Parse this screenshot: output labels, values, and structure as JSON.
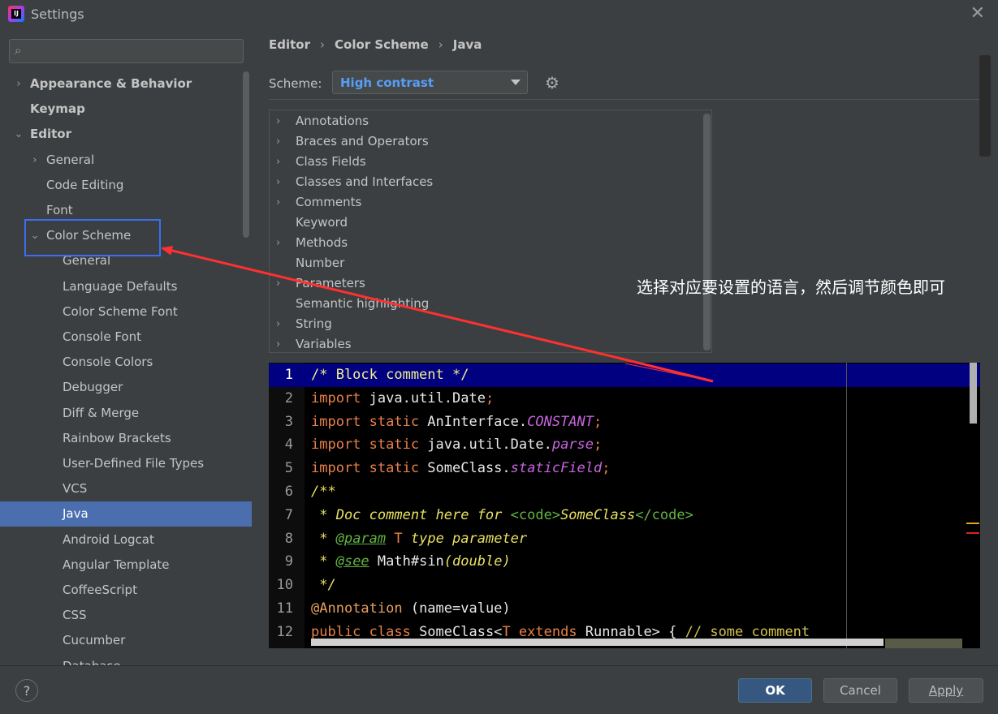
{
  "window": {
    "title": "Settings",
    "logo_text": "IJ"
  },
  "sidebar": {
    "search_placeholder": "",
    "items": [
      {
        "label": "Appearance & Behavior",
        "level": 0,
        "arrow": "›",
        "bold": true
      },
      {
        "label": "Keymap",
        "level": 0,
        "arrow": "",
        "bold": true
      },
      {
        "label": "Editor",
        "level": 0,
        "arrow": "⌄",
        "bold": true
      },
      {
        "label": "General",
        "level": 1,
        "arrow": "›"
      },
      {
        "label": "Code Editing",
        "level": 1,
        "arrow": ""
      },
      {
        "label": "Font",
        "level": 1,
        "arrow": ""
      },
      {
        "label": "Color Scheme",
        "level": 1,
        "arrow": "⌄"
      },
      {
        "label": "General",
        "level": 2,
        "arrow": ""
      },
      {
        "label": "Language Defaults",
        "level": 2,
        "arrow": ""
      },
      {
        "label": "Color Scheme Font",
        "level": 2,
        "arrow": ""
      },
      {
        "label": "Console Font",
        "level": 2,
        "arrow": ""
      },
      {
        "label": "Console Colors",
        "level": 2,
        "arrow": ""
      },
      {
        "label": "Debugger",
        "level": 2,
        "arrow": ""
      },
      {
        "label": "Diff & Merge",
        "level": 2,
        "arrow": ""
      },
      {
        "label": "Rainbow Brackets",
        "level": 2,
        "arrow": ""
      },
      {
        "label": "User-Defined File Types",
        "level": 2,
        "arrow": ""
      },
      {
        "label": "VCS",
        "level": 2,
        "arrow": ""
      },
      {
        "label": "Java",
        "level": 2,
        "arrow": "",
        "selected": true
      },
      {
        "label": "Android Logcat",
        "level": 2,
        "arrow": ""
      },
      {
        "label": "Angular Template",
        "level": 2,
        "arrow": ""
      },
      {
        "label": "CoffeeScript",
        "level": 2,
        "arrow": ""
      },
      {
        "label": "CSS",
        "level": 2,
        "arrow": ""
      },
      {
        "label": "Cucumber",
        "level": 2,
        "arrow": ""
      },
      {
        "label": "Database",
        "level": 2,
        "arrow": ""
      }
    ]
  },
  "breadcrumb": {
    "part1": "Editor",
    "part2": "Color Scheme",
    "part3": "Java",
    "sep": "›"
  },
  "scheme": {
    "label": "Scheme:",
    "value": "High contrast"
  },
  "categories": [
    {
      "label": "Annotations",
      "arrow": "›"
    },
    {
      "label": "Braces and Operators",
      "arrow": "›"
    },
    {
      "label": "Class Fields",
      "arrow": "›"
    },
    {
      "label": "Classes and Interfaces",
      "arrow": "›"
    },
    {
      "label": "Comments",
      "arrow": "›"
    },
    {
      "label": "Keyword",
      "arrow": ""
    },
    {
      "label": "Methods",
      "arrow": "›"
    },
    {
      "label": "Number",
      "arrow": ""
    },
    {
      "label": "Parameters",
      "arrow": "›"
    },
    {
      "label": "Semantic highlighting",
      "arrow": ""
    },
    {
      "label": "String",
      "arrow": "›"
    },
    {
      "label": "Variables",
      "arrow": "›"
    }
  ],
  "annotation_text": "选择对应要设置的语言，然后调节颜色即可",
  "editor": {
    "current_line": 1,
    "lines": [
      {
        "n": "1",
        "parts": [
          [
            "c-com",
            "/* Block comment */"
          ]
        ]
      },
      {
        "n": "2",
        "parts": [
          [
            "c-kw",
            "import"
          ],
          [
            "",
            " java.util.Date"
          ],
          [
            "c-kw",
            ";"
          ]
        ]
      },
      {
        "n": "3",
        "parts": [
          [
            "c-kw",
            "import static"
          ],
          [
            "",
            " AnInterface."
          ],
          [
            "c-const",
            "CONSTANT"
          ],
          [
            "c-kw",
            ";"
          ]
        ]
      },
      {
        "n": "4",
        "parts": [
          [
            "c-kw",
            "import static"
          ],
          [
            "",
            " java.util.Date."
          ],
          [
            "c-const",
            "parse"
          ],
          [
            "c-kw",
            ";"
          ]
        ]
      },
      {
        "n": "5",
        "parts": [
          [
            "c-kw",
            "import static"
          ],
          [
            "",
            " SomeClass."
          ],
          [
            "c-const",
            "staticField"
          ],
          [
            "c-kw",
            ";"
          ]
        ]
      },
      {
        "n": "6",
        "parts": [
          [
            "c-doc",
            "/**"
          ]
        ]
      },
      {
        "n": "7",
        "parts": [
          [
            "c-doc",
            " * Doc comment here for "
          ],
          [
            "c-tag",
            "<code>"
          ],
          [
            "c-doc",
            "SomeClass"
          ],
          [
            "c-tag",
            "</code>"
          ]
        ]
      },
      {
        "n": "8",
        "parts": [
          [
            "c-doc",
            " * "
          ],
          [
            "c-dtag",
            "@param"
          ],
          [
            "c-type",
            " T"
          ],
          [
            "c-doc",
            " type parameter"
          ]
        ]
      },
      {
        "n": "9",
        "parts": [
          [
            "c-doc",
            " * "
          ],
          [
            "c-dtag",
            "@see"
          ],
          [
            "",
            " Math#sin"
          ],
          [
            "c-doc",
            "(double)"
          ]
        ]
      },
      {
        "n": "10",
        "parts": [
          [
            "c-doc",
            " */"
          ]
        ]
      },
      {
        "n": "11",
        "parts": [
          [
            "c-ann",
            "@Annotation"
          ],
          [
            "",
            " (name=value)"
          ]
        ]
      },
      {
        "n": "12",
        "parts": [
          [
            "c-kw",
            "public class"
          ],
          [
            "",
            " SomeClass<"
          ],
          [
            "c-type",
            "T"
          ],
          [
            "c-kw",
            " extends"
          ],
          [
            "",
            " Runnable> { "
          ],
          [
            "c-lcom",
            "// some comment"
          ]
        ]
      }
    ]
  },
  "footer": {
    "help": "?",
    "ok": "OK",
    "cancel": "Cancel",
    "apply": "Apply"
  },
  "colors": {
    "accent": "#4b6eaf",
    "highlight_box": "#3b6ff0",
    "arrow": "#ff3030",
    "scheme_value": "#589df6"
  }
}
